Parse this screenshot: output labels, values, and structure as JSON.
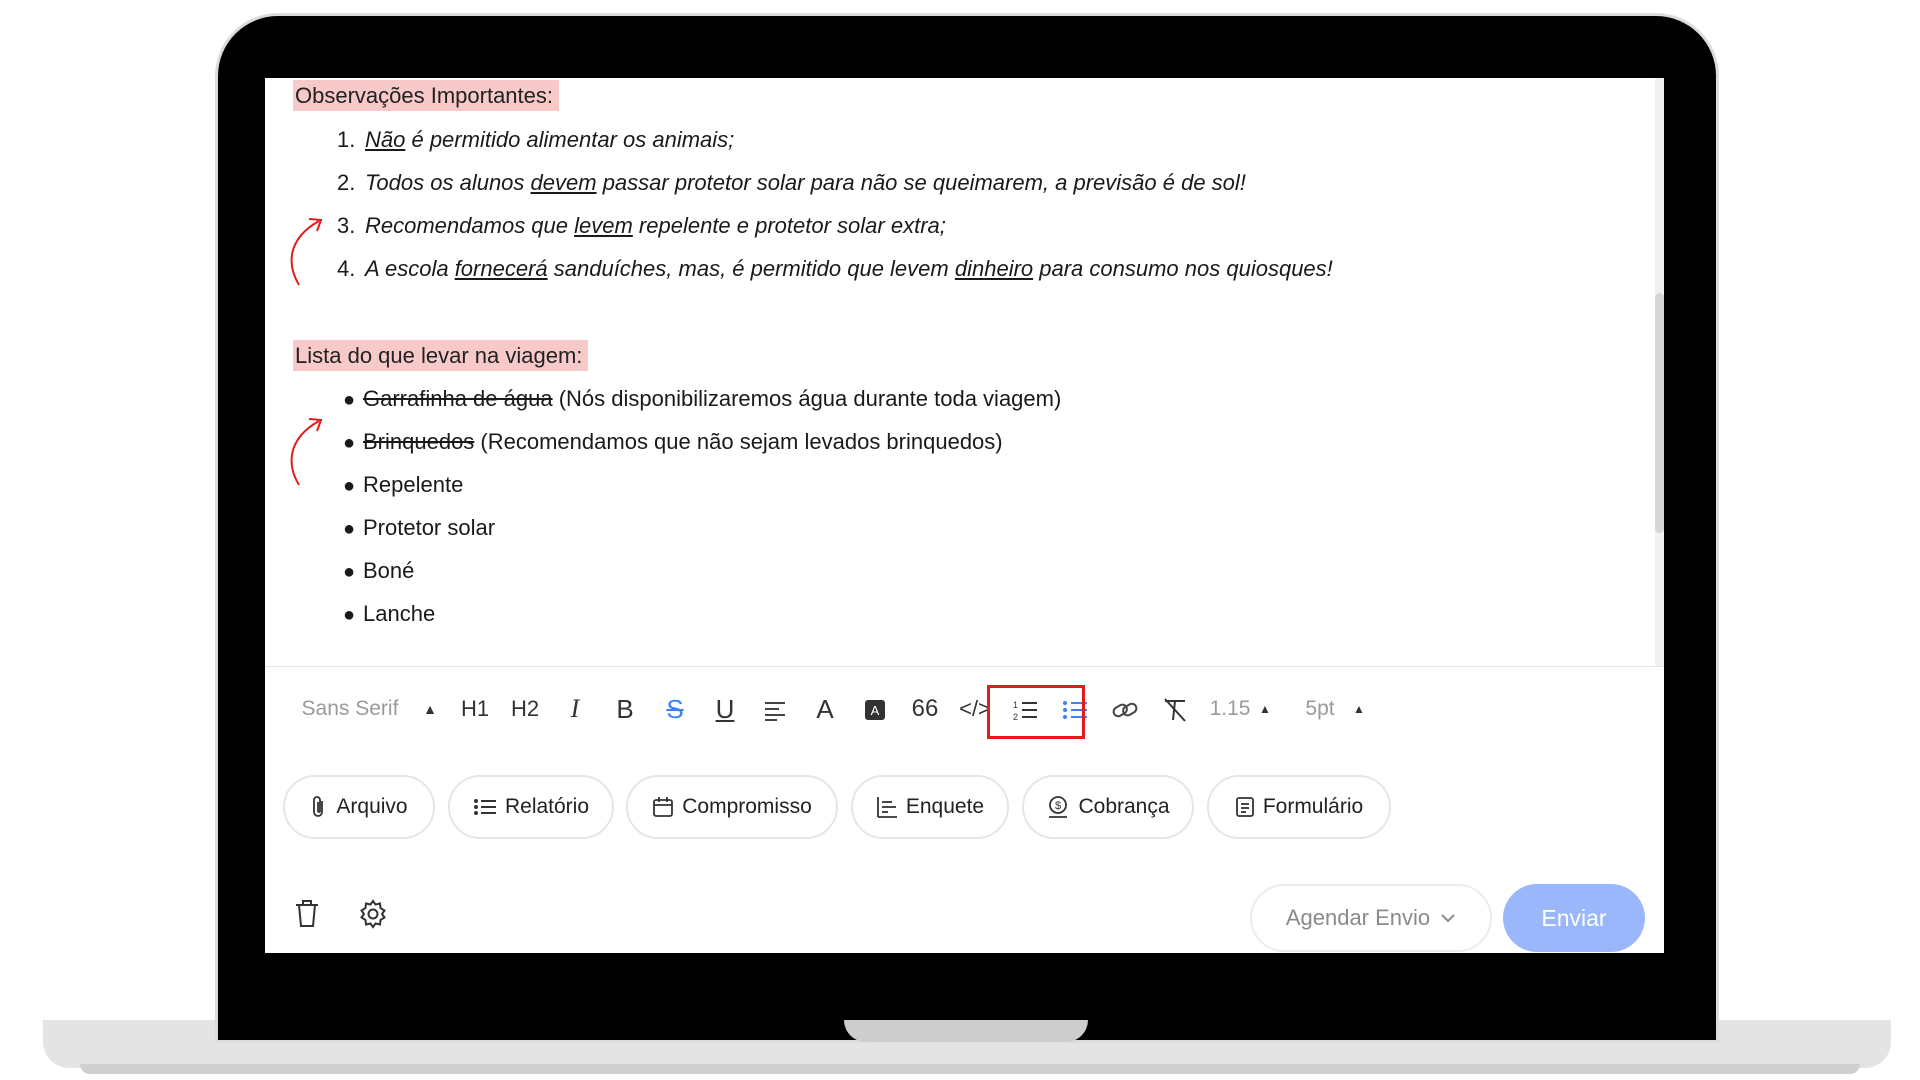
{
  "editor": {
    "section1_title": "Observações Importantes:",
    "numbered_items": [
      {
        "num": "1.",
        "parts": [
          {
            "t": "Não",
            "u": true
          },
          {
            "t": " é permitido alimentar os animais;",
            "u": false
          }
        ]
      },
      {
        "num": "2.",
        "parts": [
          {
            "t": "Todos os alunos ",
            "u": false
          },
          {
            "t": "devem",
            "u": true
          },
          {
            "t": " passar protetor solar para não se queimarem, a previsão é de sol!",
            "u": false
          }
        ]
      },
      {
        "num": "3.",
        "parts": [
          {
            "t": "Recomendamos que ",
            "u": false
          },
          {
            "t": "levem",
            "u": true
          },
          {
            "t": " repelente e protetor solar extra;",
            "u": false
          }
        ]
      },
      {
        "num": "4.",
        "parts": [
          {
            "t": "A escola ",
            "u": false
          },
          {
            "t": "fornecerá",
            "u": true
          },
          {
            "t": " sanduíches, mas, é permitido que levem ",
            "u": false
          },
          {
            "t": "dinheiro",
            "u": true
          },
          {
            "t": " para consumo nos quiosques!",
            "u": false
          }
        ]
      }
    ],
    "section2_title": "Lista do que levar na viagem:",
    "bullet_items": [
      {
        "strike": "Garrafinha de água",
        "rest": " (Nós disponibilizaremos água durante toda viagem)"
      },
      {
        "strike": "Brinquedos",
        "rest": " (Recomendamos que não sejam levados brinquedos)"
      },
      {
        "strike": "",
        "rest": "Repelente"
      },
      {
        "strike": "",
        "rest": "Protetor solar"
      },
      {
        "strike": "",
        "rest": "Boné"
      },
      {
        "strike": "",
        "rest": "Lanche"
      }
    ]
  },
  "toolbar": {
    "font_family": "Sans Serif",
    "h1": "H1",
    "h2": "H2",
    "quote": "66",
    "line_height": "1.15",
    "font_size": "5pt",
    "active_color": "#3b82f6",
    "highlight_color": "#e41b1b"
  },
  "attachments": [
    {
      "label": "Arquivo",
      "icon": "paperclip-icon"
    },
    {
      "label": "Relatório",
      "icon": "list-icon"
    },
    {
      "label": "Compromisso",
      "icon": "calendar-icon"
    },
    {
      "label": "Enquete",
      "icon": "poll-icon"
    },
    {
      "label": "Cobrança",
      "icon": "coin-icon"
    },
    {
      "label": "Formulário",
      "icon": "form-icon"
    }
  ],
  "footer": {
    "schedule_label": "Agendar Envio",
    "send_label": "Enviar"
  }
}
